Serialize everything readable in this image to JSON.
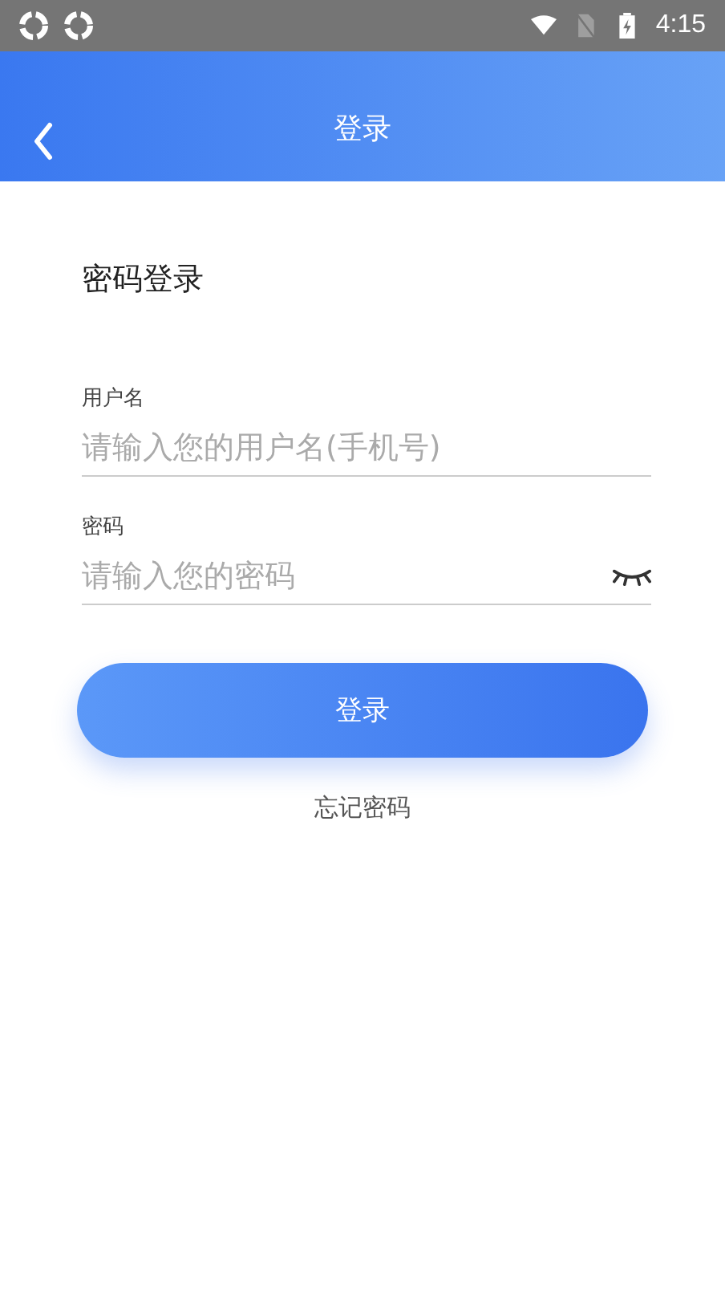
{
  "status_bar": {
    "time": "4:15"
  },
  "header": {
    "title": "登录"
  },
  "heading": "密码登录",
  "fields": [
    {
      "label": "用户名",
      "placeholder": "请输入您的用户名(手机号)",
      "kind": "text"
    },
    {
      "label": "密码",
      "placeholder": "请输入您的密码",
      "kind": "password"
    }
  ],
  "login_button": "登录",
  "forgot_link": "忘记密码"
}
